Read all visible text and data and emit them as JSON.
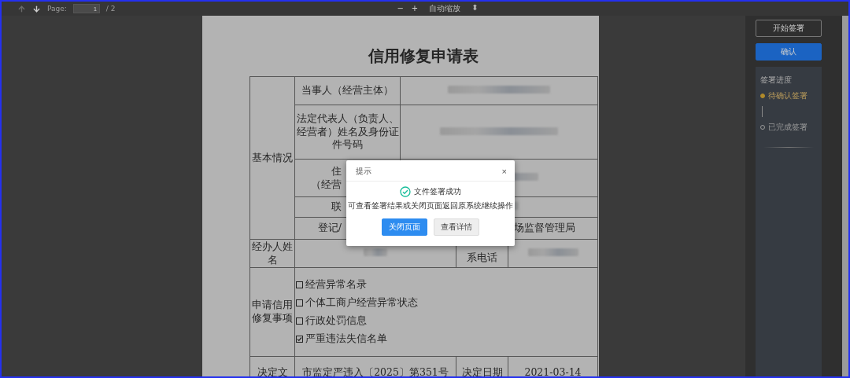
{
  "toolbar": {
    "nav": [
      {
        "kind": "up",
        "disabled": true
      },
      {
        "kind": "down",
        "disabled": false
      }
    ],
    "page_label": "Page:",
    "page_input": "1",
    "page_total": "/ 2",
    "zoom_out": "−",
    "zoom_in": "+",
    "zoom_select": "自动缩放",
    "select_caret": "⬍"
  },
  "document": {
    "title": "信用修复申请表",
    "basic": {
      "label": "基本情况",
      "fields": [
        {
          "label_lines": [
            "当事人（经营主体）"
          ],
          "redacted": true
        },
        {
          "label_lines": [
            "法定代表人（负责人、经营者）姓名及身份证件号码"
          ],
          "redacted": true
        },
        {
          "label_lines": [
            "住",
            "（经营"
          ],
          "redacted": true,
          "kind": "partial"
        },
        {
          "label_lines": [
            "联"
          ],
          "redacted": true,
          "kind": "partial"
        },
        {
          "label_lines": [
            "登记/"
          ],
          "redacted": false,
          "value": "场监督管理局",
          "kind": "partial"
        }
      ]
    },
    "handler": {
      "label": "经办人姓名",
      "name_redacted": true,
      "phone_label": "系电话",
      "phone_redacted": true
    },
    "matters": {
      "label": "申请信用修复事项",
      "options": [
        {
          "label": "经营异常名录",
          "checked": false
        },
        {
          "label": "个体工商户经营异常状态",
          "checked": false
        },
        {
          "label": "行政处罚信息",
          "checked": false
        },
        {
          "label": "严重违法失信名单",
          "checked": true
        }
      ]
    },
    "decision": {
      "label": "决定文",
      "number": "市监定严违入〔2025〕第351号",
      "date_label": "决定日期",
      "date": "2021-03-14"
    }
  },
  "sidebar": {
    "buttons": [
      {
        "label": "开始签署",
        "kind": "outline"
      },
      {
        "label": "确认",
        "kind": "primary"
      }
    ],
    "progress": {
      "title": "签署进度",
      "steps": [
        {
          "label": "待确认签署",
          "selected": true
        },
        {
          "label": "已完成签署",
          "selected": false
        }
      ]
    }
  },
  "dialog": {
    "title": "提示",
    "close": "×",
    "message": "文件签署成功",
    "detail": "可查看签署结果或关闭页面返回原系统继续操作",
    "buttons": [
      {
        "label": "关闭页面",
        "kind": "primary"
      },
      {
        "label": "查看详情",
        "kind": "default"
      }
    ]
  }
}
